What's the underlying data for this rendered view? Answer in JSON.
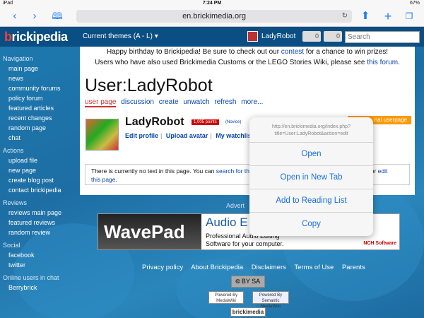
{
  "status": {
    "device": "iPad",
    "time": "7:24 PM",
    "battery": "67%"
  },
  "browser": {
    "url": "en.brickimedia.org"
  },
  "site": {
    "logo_prefix": "b",
    "logo_rest": "rickipedia",
    "themes_label": "Current themes (A - L)",
    "username": "LadyRobot",
    "msg_count": "0",
    "notif_count": "0",
    "search_placeholder": "Search"
  },
  "sidebar": {
    "navigation": {
      "heading": "Navigation",
      "items": [
        "main page",
        "news",
        "community forums",
        "policy forum",
        "featured articles",
        "recent changes",
        "random page",
        "chat"
      ]
    },
    "actions": {
      "heading": "Actions",
      "items": [
        "upload file",
        "new page",
        "create blog post",
        "contact brickipedia"
      ]
    },
    "reviews": {
      "heading": "Reviews",
      "items": [
        "reviews main page",
        "featured reviews",
        "random review"
      ]
    },
    "social": {
      "heading": "Social",
      "items": [
        "facebook",
        "twitter"
      ]
    },
    "online": {
      "heading": "Online users in chat",
      "items": [
        "Berrybrick"
      ]
    }
  },
  "content": {
    "notice1_pre": "Happy birthday to Brickipedia! Be sure to check out our ",
    "notice1_link": "contest",
    "notice1_post": " for a chance to win prizes!",
    "notice2_pre": "Users who have also used Brickimedia Customs or the LEGO Stories Wiki, please see ",
    "notice2_link": "this forum",
    "notice2_post": ".",
    "title": "User:LadyRobot",
    "tabs": [
      "user page",
      "discussion",
      "create",
      "unwatch",
      "refresh",
      "more..."
    ],
    "profile_name": "LadyRobot",
    "points": "1,005 points",
    "rank": "(Novice)",
    "links": [
      "Edit profile",
      "Upload avatar",
      "My watchlist"
    ],
    "orange_label": "nal userpage",
    "empty_pre": "There is currently no text in this page. You can ",
    "empty_link": "search for this",
    "empty_tail": ", or ",
    "empty_edit": "edit",
    "empty_line2_link": "this page",
    "empty_line2_post": "."
  },
  "ad": {
    "label": "Advert",
    "brand": "WavePad",
    "headline": "Audio E",
    "line1": "Professional Audio Editing",
    "line2": "Software for your computer.",
    "vendor": "NCH Software"
  },
  "footer": {
    "links": [
      "Privacy policy",
      "About Brickipedia",
      "Disclaimers",
      "Terms of Use",
      "Parents"
    ],
    "powered1": "Powered By MediaWiki",
    "powered2": "Powered By Semantic MediaWiki",
    "footer_logo": "brickimedia"
  },
  "context_menu": {
    "url": "http://en.brickimedia.org/index.php?title=User:LadyRobot&action=edit",
    "options": [
      "Open",
      "Open in New Tab",
      "Add to Reading List",
      "Copy"
    ]
  },
  "colors": {
    "header": "#0b4e84",
    "link": "#0645ad",
    "accent": "#1a6ee8",
    "points": "#c00"
  }
}
